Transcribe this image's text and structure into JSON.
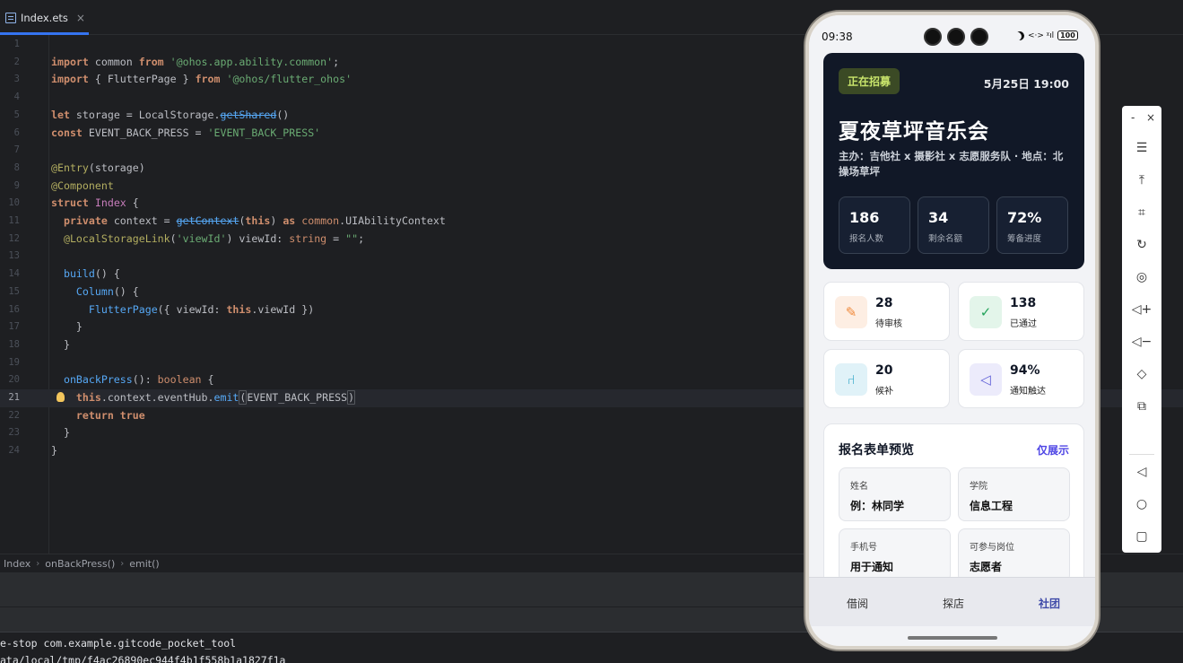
{
  "tab": {
    "label": "Index.ets",
    "close": "×"
  },
  "code_lines": [
    {
      "n": "1",
      "html": ""
    },
    {
      "n": "2",
      "html": "<span class='kw'>import</span> common <span class='kw'>from</span> <span class='str'>'@ohos.app.ability.common'</span>;"
    },
    {
      "n": "3",
      "html": "<span class='kw'>import</span> { FlutterPage } <span class='kw'>from</span> <span class='str'>'@ohos/flutter_ohos'</span>"
    },
    {
      "n": "4",
      "html": ""
    },
    {
      "n": "5",
      "html": "<span class='kw'>let</span> storage = LocalStorage.<span class='strike'>getShared</span>()"
    },
    {
      "n": "6",
      "html": "<span class='kw'>const</span> EVENT_BACK_PRESS = <span class='str'>'EVENT_BACK_PRESS'</span>"
    },
    {
      "n": "7",
      "html": ""
    },
    {
      "n": "8",
      "html": "<span class='ann'>@Entry</span>(storage)"
    },
    {
      "n": "9",
      "html": "<span class='ann'>@Component</span>"
    },
    {
      "n": "10",
      "html": "<span class='kw'>struct</span> <span class='ty'>Index</span> {"
    },
    {
      "n": "11",
      "html": "  <span class='kw'>private</span> context = <span class='strike'>getContext</span>(<span class='kw'>this</span>) <span class='kw'>as</span> <span class='typ'>common</span>.UIAbilityContext"
    },
    {
      "n": "12",
      "html": "  <span class='ann'>@LocalStorageLink</span>(<span class='str'>'viewId'</span>) viewId: <span class='typ'>string</span> = <span class='str'>\"\"</span>;"
    },
    {
      "n": "13",
      "html": ""
    },
    {
      "n": "14",
      "html": "  <span class='fn'>build</span>() {"
    },
    {
      "n": "15",
      "html": "    <span class='fn'>Column</span>() {"
    },
    {
      "n": "16",
      "html": "      <span class='fn'>FlutterPage</span>({ viewId: <span class='kw'>this</span>.viewId })"
    },
    {
      "n": "17",
      "html": "    }"
    },
    {
      "n": "18",
      "html": "  }"
    },
    {
      "n": "19",
      "html": ""
    },
    {
      "n": "20",
      "html": "  <span class='fn'>onBackPress</span>(): <span class='typ'>boolean</span> {"
    },
    {
      "n": "21",
      "html": "    <span class='kw'>this</span>.context.eventHub.<span class='sym'>emit</span><span class='bracket'>(</span>EVENT_BACK_PRESS<span class='bracket'>)</span>"
    },
    {
      "n": "22",
      "html": "    <span class='kw'>return</span> <span class='kw'>true</span>"
    },
    {
      "n": "23",
      "html": "  }"
    },
    {
      "n": "24",
      "html": "}"
    }
  ],
  "breadcrumbs": [
    "Index",
    "onBackPress()",
    "emit()"
  ],
  "terminal": [
    "e-stop com.example.gitcode_pocket_tool",
    "ata/local/tmp/f4ac26890ec944f4b1f558b1a1827f1a"
  ],
  "phone": {
    "status": {
      "time": "09:38",
      "battery": "100"
    },
    "hero": {
      "badge": "正在招募",
      "date": "5月25日 19:00",
      "title": "夏夜草坪音乐会",
      "subtitle": "主办：吉他社 x 摄影社 x 志愿服务队 · 地点：北操场草坪",
      "stats": [
        {
          "value": "186",
          "label": "报名人数"
        },
        {
          "value": "34",
          "label": "剩余名额"
        },
        {
          "value": "72%",
          "label": "筹备进度"
        }
      ]
    },
    "cards": [
      {
        "value": "28",
        "label": "待审核",
        "icon": "pen-icon",
        "color": "#f08a3c",
        "bg": "#fdeee3"
      },
      {
        "value": "138",
        "label": "已通过",
        "icon": "check-badge-icon",
        "color": "#22a35a",
        "bg": "#e3f5ea"
      },
      {
        "value": "20",
        "label": "候补",
        "icon": "seat-icon",
        "color": "#1e9ec2",
        "bg": "#e0f2f8"
      },
      {
        "value": "94%",
        "label": "通知触达",
        "icon": "megaphone-icon",
        "color": "#5b5bd6",
        "bg": "#ecebfb"
      }
    ],
    "form": {
      "title": "报名表单预览",
      "link": "仅展示",
      "fields": [
        {
          "label": "姓名",
          "value": "例：林同学"
        },
        {
          "label": "学院",
          "value": "信息工程"
        },
        {
          "label": "手机号",
          "value": "用于通知"
        },
        {
          "label": "可参与岗位",
          "value": "志愿者"
        }
      ]
    },
    "nav": [
      "借阅",
      "探店",
      "社团"
    ]
  },
  "sidetool": {
    "minimize": "-",
    "close": "×",
    "tools": [
      "menu-icon",
      "pin-top-icon",
      "crop-icon",
      "rotate-icon",
      "screenshot-icon",
      "volume-up-icon",
      "volume-down-icon",
      "shake-icon",
      "multi-device-icon",
      "back-icon",
      "home-icon",
      "recents-icon"
    ]
  }
}
